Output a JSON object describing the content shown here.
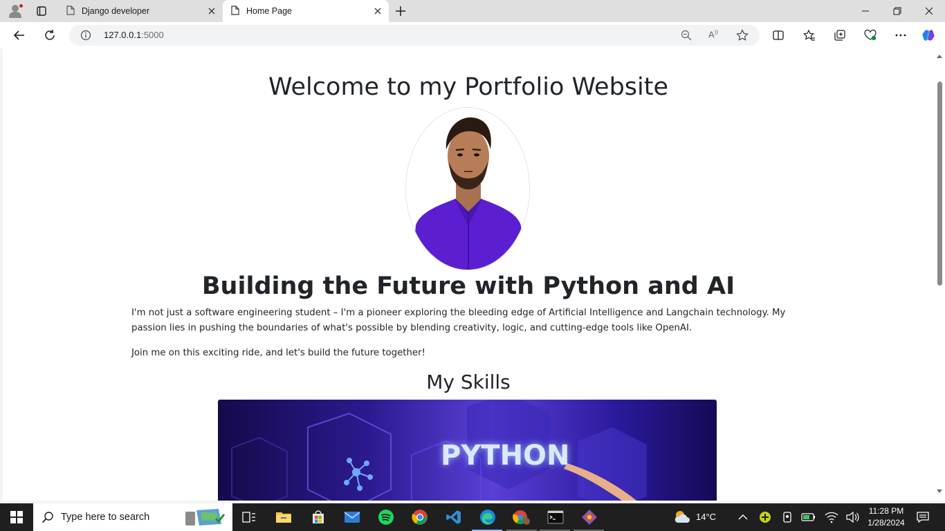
{
  "browser": {
    "tabs": [
      {
        "title": "Django developer",
        "active": false
      },
      {
        "title": "Home Page",
        "active": true
      }
    ],
    "address": {
      "host": "127.0.0.1",
      "port": ":5000"
    }
  },
  "page": {
    "heading": "Welcome to my Portfolio Website",
    "tagline": "Building the Future with Python and AI",
    "intro": "I'm not just a software engineering student – I'm a pioneer exploring the bleeding edge of Artificial Intelligence and Langchain technology. My passion lies in pushing the boundaries of what's possible by blending creativity, logic, and cutting-edge tools like OpenAI.",
    "cta": "Join me on this exciting ride, and let's build the future together!",
    "skills_heading": "My Skills",
    "skills_image_text": "PYTHON"
  },
  "taskbar": {
    "search_placeholder": "Type here to search",
    "weather": "14°C",
    "time": "11:28 PM",
    "date": "1/28/2024"
  },
  "colors": {
    "accent": "#0067c0",
    "text": "#212529",
    "shirt": "#5b1fd1"
  }
}
